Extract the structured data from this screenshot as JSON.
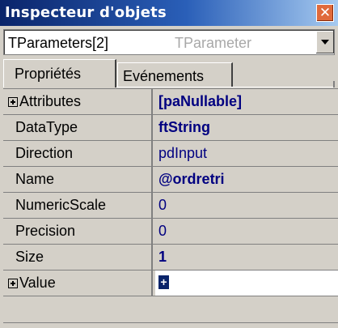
{
  "window": {
    "title": "Inspecteur d'objets",
    "close_glyph": "✕",
    "title_gradient": [
      "#0a246a",
      "#a6caf0"
    ]
  },
  "object_selector": {
    "name": "TParameters[2]",
    "type": "TParameter",
    "dropdown_icon": "chevron-down-icon"
  },
  "tabs": [
    {
      "label": "Propriétés",
      "active": true
    },
    {
      "label": "Evénements",
      "active": false
    }
  ],
  "properties": [
    {
      "name": "Attributes",
      "value": "[paNullable]",
      "expandable": true,
      "value_bold": true
    },
    {
      "name": "DataType",
      "value": "ftString",
      "expandable": false,
      "value_bold": true
    },
    {
      "name": "Direction",
      "value": "pdInput",
      "expandable": false,
      "value_bold": false
    },
    {
      "name": "Name",
      "value": "@ordretri",
      "expandable": false,
      "value_bold": true
    },
    {
      "name": "NumericScale",
      "value": "0",
      "expandable": false,
      "value_bold": false
    },
    {
      "name": "Precision",
      "value": "0",
      "expandable": false,
      "value_bold": false
    },
    {
      "name": "Size",
      "value": "1",
      "expandable": false,
      "value_bold": true
    },
    {
      "name": "Value",
      "value": "+",
      "expandable": true,
      "value_bold": true,
      "selected": true
    }
  ],
  "colors": {
    "value_text": "#000080",
    "face": "#d4d0c8",
    "close_button": "#e06a3b"
  }
}
